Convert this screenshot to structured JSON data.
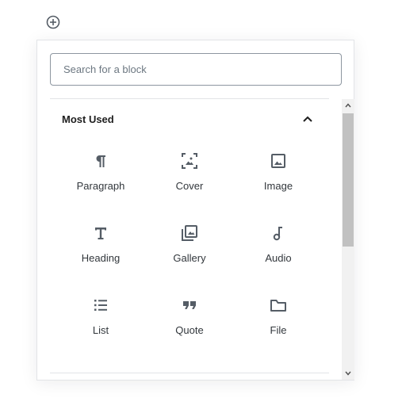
{
  "inserter": {
    "search": {
      "placeholder": "Search for a block",
      "value": ""
    },
    "panel": {
      "title": "Most Used",
      "expanded": true,
      "blocks": [
        {
          "label": "Paragraph",
          "icon": "paragraph-icon"
        },
        {
          "label": "Cover",
          "icon": "cover-icon"
        },
        {
          "label": "Image",
          "icon": "image-icon"
        },
        {
          "label": "Heading",
          "icon": "heading-icon"
        },
        {
          "label": "Gallery",
          "icon": "gallery-icon"
        },
        {
          "label": "Audio",
          "icon": "audio-icon"
        },
        {
          "label": "List",
          "icon": "list-icon"
        },
        {
          "label": "Quote",
          "icon": "quote-icon"
        },
        {
          "label": "File",
          "icon": "file-icon"
        }
      ]
    }
  },
  "colors": {
    "icon": "#555d66",
    "text": "#32373c",
    "border": "#e2e4e7",
    "input_border": "#8d96a0",
    "scrollbar_thumb": "#c1c1c1"
  }
}
